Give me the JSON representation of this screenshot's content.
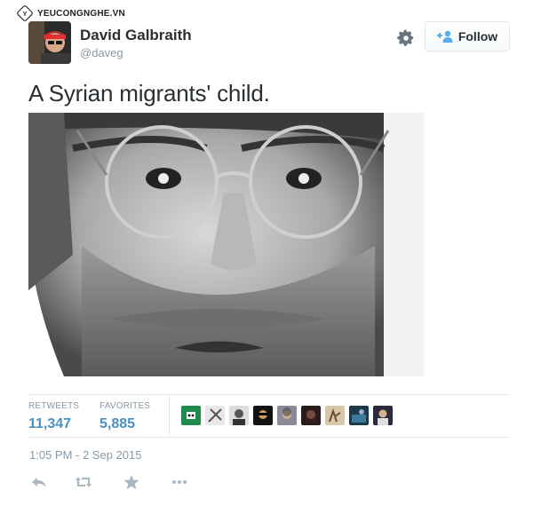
{
  "watermark": {
    "text": "YEUCONGNGHE.VN"
  },
  "user": {
    "name": "David Galbraith",
    "handle": "@daveg"
  },
  "header": {
    "settings_icon": "gear-icon",
    "follow_label": "Follow",
    "follow_icon": "add-user-icon"
  },
  "tweet": {
    "text": "A Syrian migrants' child."
  },
  "stats": {
    "retweets_label": "RETWEETS",
    "retweets_value": "11,347",
    "favorites_label": "FAVORITES",
    "favorites_value": "5,885"
  },
  "favorited_by_count_shown": 9,
  "timestamp": "1:05 PM - 2 Sep 2015",
  "actions": [
    "reply-icon",
    "retweet-icon",
    "favorite-icon",
    "more-icon"
  ],
  "colors": {
    "accent": "#4a90c2",
    "muted": "#8899a6",
    "text": "#292f33",
    "border": "#e1e8ed"
  }
}
